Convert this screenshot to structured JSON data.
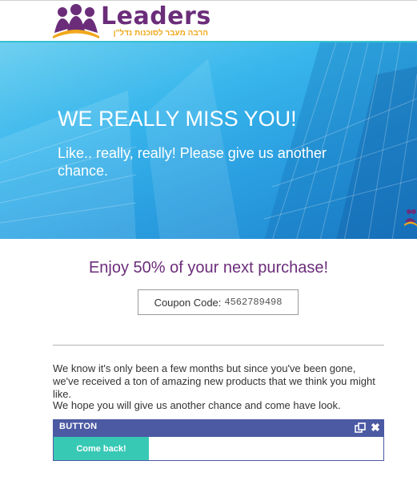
{
  "header": {
    "logo_text": "Leaders",
    "logo_tagline": "הרבה מעבר לסוכנות נדל\"ן"
  },
  "hero": {
    "title": "WE REALLY MISS YOU!",
    "subtitle": "Like.. really, really! Please give us another chance."
  },
  "offer": {
    "headline": "Enjoy 50% of your next purchase!",
    "coupon_label": "Coupon Code:",
    "coupon_code": "4562789498"
  },
  "body": {
    "paragraph_1": "We know it's only been a few months but since you've been gone, we've received a ton of amazing new products that we think you might like.",
    "paragraph_2": "We hope you will give us another chance and come have look."
  },
  "editor": {
    "block_label": "BUTTON",
    "button_label": "Come back!",
    "close_glyph": "✖"
  },
  "colors": {
    "brand_purple": "#6b2d7a",
    "brand_orange": "#f0a81c",
    "editor_bar": "#4b5aa3",
    "cta_teal": "#38c9b5",
    "hero_blue": "#2a9ee0"
  },
  "icons": {
    "logo": "people-group-logo",
    "copy": "duplicate-icon",
    "close": "close-icon"
  }
}
